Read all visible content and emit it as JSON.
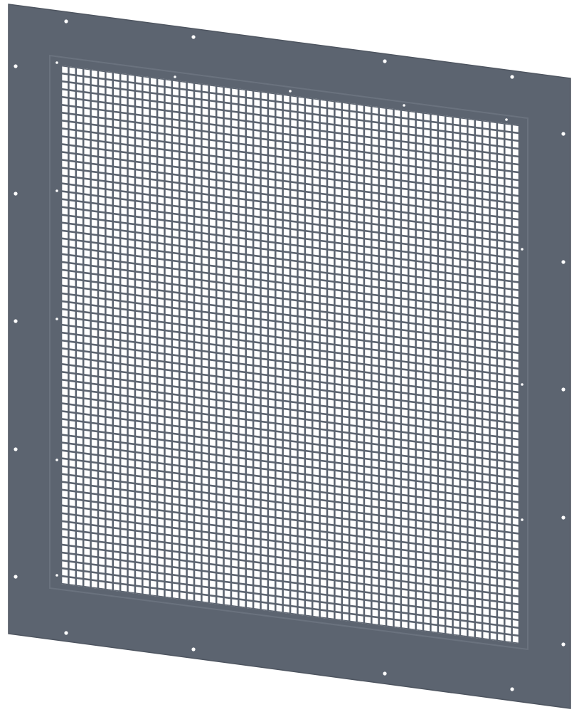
{
  "panel": {
    "plate_color": "#5c6470",
    "plate_edge_color": "#4e5560",
    "frame_highlight_color": "#6a727e",
    "mesh_background_color": "#ffffff",
    "hole_color": "#ffffff",
    "mesh_grid_columns": 62,
    "mesh_grid_rows": 66,
    "perimeter_hole_count": 30
  }
}
